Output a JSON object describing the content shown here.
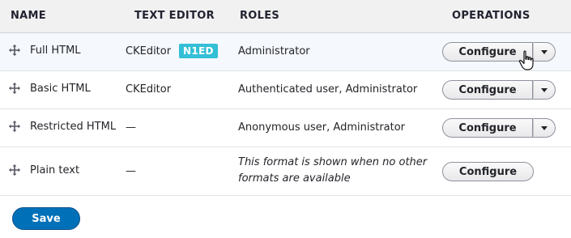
{
  "table": {
    "headers": {
      "name": "NAME",
      "text_editor": "TEXT EDITOR",
      "roles": "ROLES",
      "operations": "OPERATIONS"
    },
    "rows": [
      {
        "name": "Full HTML",
        "editor": "CKEditor",
        "editor_badge": "N1ED",
        "roles": "Administrator",
        "operation": "Configure",
        "has_dropdown": true
      },
      {
        "name": "Basic HTML",
        "editor": "CKEditor",
        "roles": "Authenticated user, Administrator",
        "operation": "Configure",
        "has_dropdown": true
      },
      {
        "name": "Restricted HTML",
        "editor": "—",
        "roles": "Anonymous user, Administrator",
        "operation": "Configure",
        "has_dropdown": true
      },
      {
        "name": "Plain text",
        "editor": "—",
        "roles_line1": "This format is shown when no other",
        "roles_line2": "formats are available",
        "operation": "Configure",
        "has_dropdown": false
      }
    ]
  },
  "actions": {
    "save_label": "Save"
  },
  "colors": {
    "badge": "#33bfd6",
    "primary": "#0071b8",
    "hover_row": "#f5f8fc"
  }
}
